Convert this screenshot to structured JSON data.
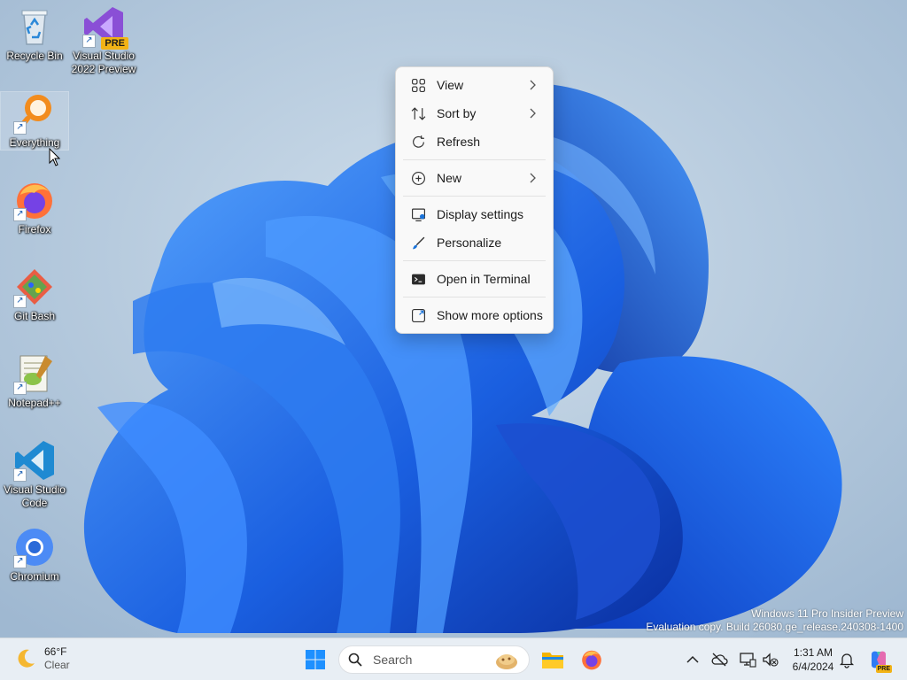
{
  "desktop": {
    "icons": [
      {
        "label": "Recycle Bin",
        "icon": "recycle-bin-icon"
      },
      {
        "label": "Visual Studio 2022 Preview",
        "icon": "visual-studio-icon",
        "badge": "PRE"
      },
      {
        "label": "Everything",
        "icon": "everything-search-icon"
      },
      {
        "label": "Firefox",
        "icon": "firefox-icon"
      },
      {
        "label": "Git Bash",
        "icon": "git-bash-icon"
      },
      {
        "label": "Notepad++",
        "icon": "notepadpp-icon"
      },
      {
        "label": "Visual Studio Code",
        "icon": "vscode-icon"
      },
      {
        "label": "Chromium",
        "icon": "chromium-icon"
      }
    ]
  },
  "context_menu": {
    "items": [
      {
        "label": "View",
        "icon": "grid-view-icon",
        "submenu": true
      },
      {
        "label": "Sort by",
        "icon": "sort-icon",
        "submenu": true
      },
      {
        "label": "Refresh",
        "icon": "refresh-icon",
        "submenu": false
      },
      {
        "label": "New",
        "icon": "plus-circle-icon",
        "submenu": true
      },
      {
        "label": "Display settings",
        "icon": "display-icon",
        "submenu": false
      },
      {
        "label": "Personalize",
        "icon": "brush-icon",
        "submenu": false
      },
      {
        "label": "Open in Terminal",
        "icon": "terminal-icon",
        "submenu": false
      },
      {
        "label": "Show more options",
        "icon": "expand-icon",
        "submenu": false
      }
    ]
  },
  "watermark": {
    "line1": "Windows 11 Pro Insider Preview",
    "line2": "Evaluation copy. Build 26080.ge_release.240308-1400"
  },
  "taskbar": {
    "weather": {
      "temp": "66°F",
      "condition": "Clear",
      "icon": "moon-icon"
    },
    "search": {
      "placeholder": "Search"
    },
    "apps": [
      "start-icon",
      "file-explorer-icon",
      "firefox-icon"
    ],
    "tray_icons": [
      "chevron-up-icon",
      "onedrive-icon",
      "network-icon",
      "volume-muted-icon",
      "notification-bell-icon",
      "copilot-icon"
    ],
    "copilot_badge": "PRE",
    "clock": {
      "time": "1:31 AM",
      "date": "6/4/2024"
    }
  },
  "colors": {
    "accent": "#0067c0",
    "taskbar_bg": "#e8eef4",
    "menu_bg": "#f9f9f9"
  }
}
